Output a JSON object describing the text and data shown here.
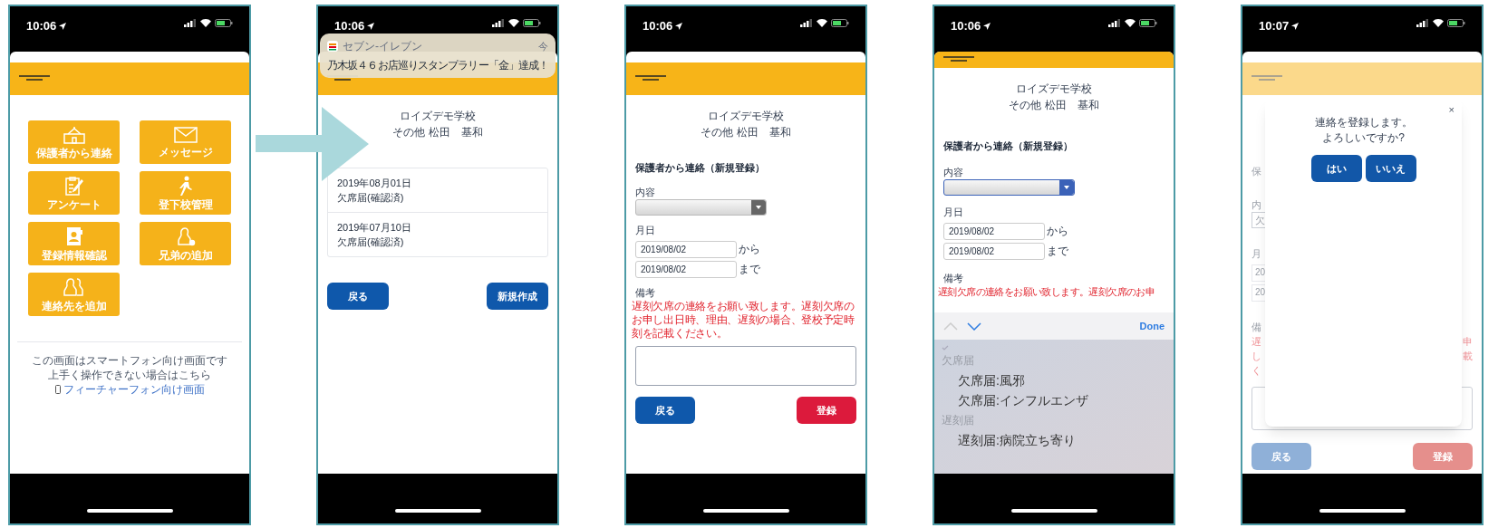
{
  "screens": [
    {
      "kind": "menu",
      "time": "10:06",
      "tiles": [
        {
          "label": "保護者から連絡",
          "kind": "school"
        },
        {
          "label": "メッセージ",
          "kind": "mail"
        },
        {
          "label": "アンケート",
          "kind": "clipboard"
        },
        {
          "label": "登下校管理",
          "kind": "walk"
        },
        {
          "label": "登録情報確認",
          "kind": "card"
        },
        {
          "label": "兄弟の追加",
          "kind": "person-add"
        },
        {
          "label": "連絡先を追加",
          "kind": "people"
        }
      ],
      "footer_lines": [
        "この画面はスマートフォン向け画面です",
        "上手く操作できない場合はこちら"
      ],
      "footer_link": "フィーチャーフォン向け画面"
    },
    {
      "kind": "list",
      "time": "10:06",
      "notification": {
        "app": "セブン-イレブン",
        "when": "今",
        "message": "乃木坂４６お店巡りスタンプラリー「金」達成！"
      },
      "school": "ロイズデモ学校",
      "user": "その他 松田　基和",
      "entries": [
        {
          "date": "2019年08月01日",
          "status": "欠席届(確認済)"
        },
        {
          "date": "2019年07月10日",
          "status": "欠席届(確認済)"
        }
      ],
      "buttons": [
        {
          "label": "戻る",
          "kind": "back"
        },
        {
          "label": "新規作成",
          "kind": "primary"
        }
      ]
    },
    {
      "kind": "form",
      "time": "10:06",
      "school": "ロイズデモ学校",
      "user": "その他 松田　基和",
      "heading": "保護者から連絡（新規登録）",
      "content_label": "内容",
      "select": {
        "focused": false
      },
      "date_label": "月日",
      "dates": [
        {
          "value": "2019/08/02",
          "suffix": "から"
        },
        {
          "value": "2019/08/02",
          "suffix": "まで"
        }
      ],
      "notes_label": "備考",
      "notes_hint": "遅刻欠席の連絡をお願い致します。遅刻欠席のお申し出日時、理由、遅刻の場合、登校予定時刻を記載ください。",
      "buttons": [
        {
          "label": "戻る",
          "kind": "back"
        },
        {
          "label": "登録",
          "kind": "danger"
        }
      ]
    },
    {
      "kind": "picker",
      "time": "10:06",
      "school": "ロイズデモ学校",
      "user": "その他 松田　基和",
      "heading": "保護者から連絡（新規登録）",
      "content_label": "内容",
      "select": {
        "focused": true
      },
      "date_label": "月日",
      "dates": [
        {
          "value": "2019/08/02",
          "suffix": "から"
        },
        {
          "value": "2019/08/02",
          "suffix": "まで"
        }
      ],
      "notes_label": "備考",
      "notes_hint": "遅刻欠席の連絡をお願い致します。遅刻欠席のお申",
      "picker": {
        "done": "Done",
        "options": [
          {
            "label": "欠席届",
            "kind": "group"
          },
          {
            "label": "欠席届:風邪",
            "kind": "option"
          },
          {
            "label": "欠席届:インフルエンザ",
            "kind": "option"
          },
          {
            "label": "遅刻届",
            "kind": "group"
          },
          {
            "label": "遅刻届:病院立ち寄り",
            "kind": "option"
          }
        ]
      }
    },
    {
      "kind": "dialog",
      "time": "10:07",
      "behind": {
        "heading": "保",
        "content_label": "内",
        "content_value": "欠",
        "date_label": "月",
        "dates": [
          "20",
          "20"
        ],
        "notes_label": "備",
        "notes_lines": [
          {
            "left": "遅",
            "right": "申"
          },
          {
            "left": "し",
            "right": "載"
          },
          {
            "left": "く"
          }
        ],
        "buttons": [
          {
            "label": "戻る",
            "kind": "back"
          },
          {
            "label": "登録",
            "kind": "danger"
          }
        ]
      },
      "dialog": {
        "lines": [
          "連絡を登録します。",
          "よろしいですか?"
        ],
        "close": "×",
        "buttons": [
          {
            "label": "はい"
          },
          {
            "label": "いいえ"
          }
        ]
      }
    }
  ]
}
